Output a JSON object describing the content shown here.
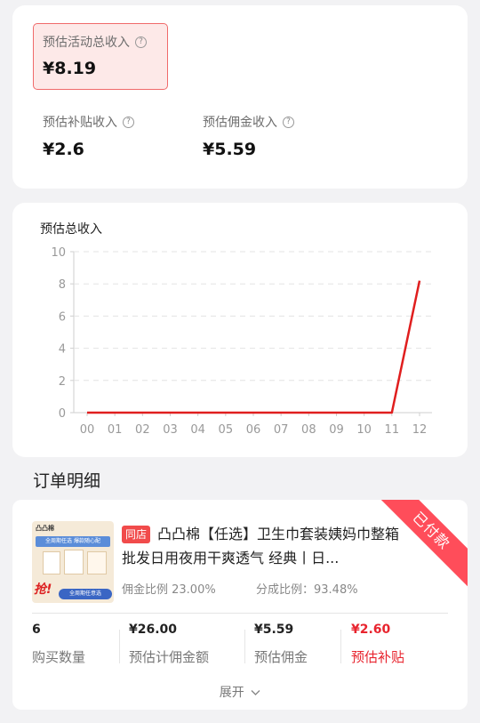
{
  "summary": {
    "total_label": "预估活动总收入",
    "total_value": "¥8.19",
    "subsidy_label": "预估补贴收入",
    "subsidy_value": "¥2.6",
    "commission_label": "预估佣金收入",
    "commission_value": "¥5.59",
    "help_icon": "?"
  },
  "chart": {
    "title": "预估总收入"
  },
  "chart_data": {
    "type": "line",
    "title": "预估总收入",
    "xlabel": "",
    "ylabel": "",
    "categories": [
      "00",
      "01",
      "02",
      "03",
      "04",
      "05",
      "06",
      "07",
      "08",
      "09",
      "10",
      "11",
      "12"
    ],
    "values": [
      0,
      0,
      0,
      0,
      0,
      0,
      0,
      0,
      0,
      0,
      0,
      0,
      8.2
    ],
    "yticks": [
      0,
      2,
      4,
      6,
      8,
      10
    ],
    "ylim": [
      0,
      10
    ],
    "grid": true,
    "line_color": "#e01e1e"
  },
  "orders": {
    "section_title": "订单明细",
    "item": {
      "shop_badge": "同店",
      "title": "凸凸棉【任选】卫生巾套装姨妈巾整箱批发日用夜用干爽透气 经典丨日...",
      "commission_rate": "佣金比例 23.00%",
      "share_rate": "分成比例：93.48%",
      "status_ribbon": "已付款",
      "stats": [
        {
          "value": "6",
          "label": "购买数量"
        },
        {
          "value": "¥26.00",
          "label": "预估计佣金额"
        },
        {
          "value": "¥5.59",
          "label": "预估佣金"
        },
        {
          "value": "¥2.60",
          "label": "预估补贴"
        }
      ],
      "expand_label": "展开",
      "thumb_text": {
        "brand": "凸凸棉",
        "promo": "全周期任选 爆款随心配",
        "grab": "抢!",
        "footer": "全周期任意选"
      }
    }
  },
  "colors": {
    "accent_red": "#e8242e",
    "ribbon": "#ff4d5a",
    "highlight_border": "#f06a6a",
    "highlight_bg": "#fde9e8"
  }
}
